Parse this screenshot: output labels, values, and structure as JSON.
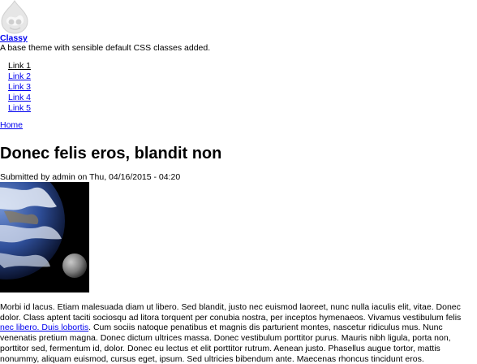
{
  "site": {
    "logo_icon": "drupal-drop-icon",
    "name": "Classy",
    "slogan": "A base theme with sensible default CSS classes added."
  },
  "main_menu": [
    {
      "label": "Link 1",
      "active": true
    },
    {
      "label": "Link 2",
      "active": false
    },
    {
      "label": "Link 3",
      "active": false
    },
    {
      "label": "Link 4",
      "active": false
    },
    {
      "label": "Link 5",
      "active": false
    }
  ],
  "breadcrumb": {
    "home": "Home"
  },
  "node": {
    "title": "Donec felis eros, blandit non",
    "submitted": "Submitted by admin on Thu, 04/16/2015 - 04:20",
    "image_icon": "earth-and-moon-image",
    "body_before_link": "Morbi id lacus. Etiam malesuada diam ut libero. Sed blandit, justo nec euismod laoreet, nunc nulla iaculis elit, vitae. Donec dolor. Class aptent taciti sociosqu ad litora torquent per conubia nostra, per inceptos hymenaeos. Vivamus vestibulum felis ",
    "body_link": "nec libero. Duis lobortis",
    "body_after_link": ". Cum sociis natoque penatibus et magnis dis parturient montes, nascetur ridiculus mus. Nunc venenatis pretium magna. Donec dictum ultrices massa. Donec vestibulum porttitor purus. Mauris nibh ligula, porta non, porttitor sed, fermentum id, dolor. Donec eu lectus et elit porttitor rutrum. Aenean justo. Phasellus augue tortor, mattis nonummy, aliquam euismod, cursus eget, ipsum. Sed ultricies bibendum ante. Maecenas rhoncus tincidunt eros."
  },
  "colors": {
    "link": "#0000ee",
    "text": "#000000",
    "background": "#ffffff"
  }
}
